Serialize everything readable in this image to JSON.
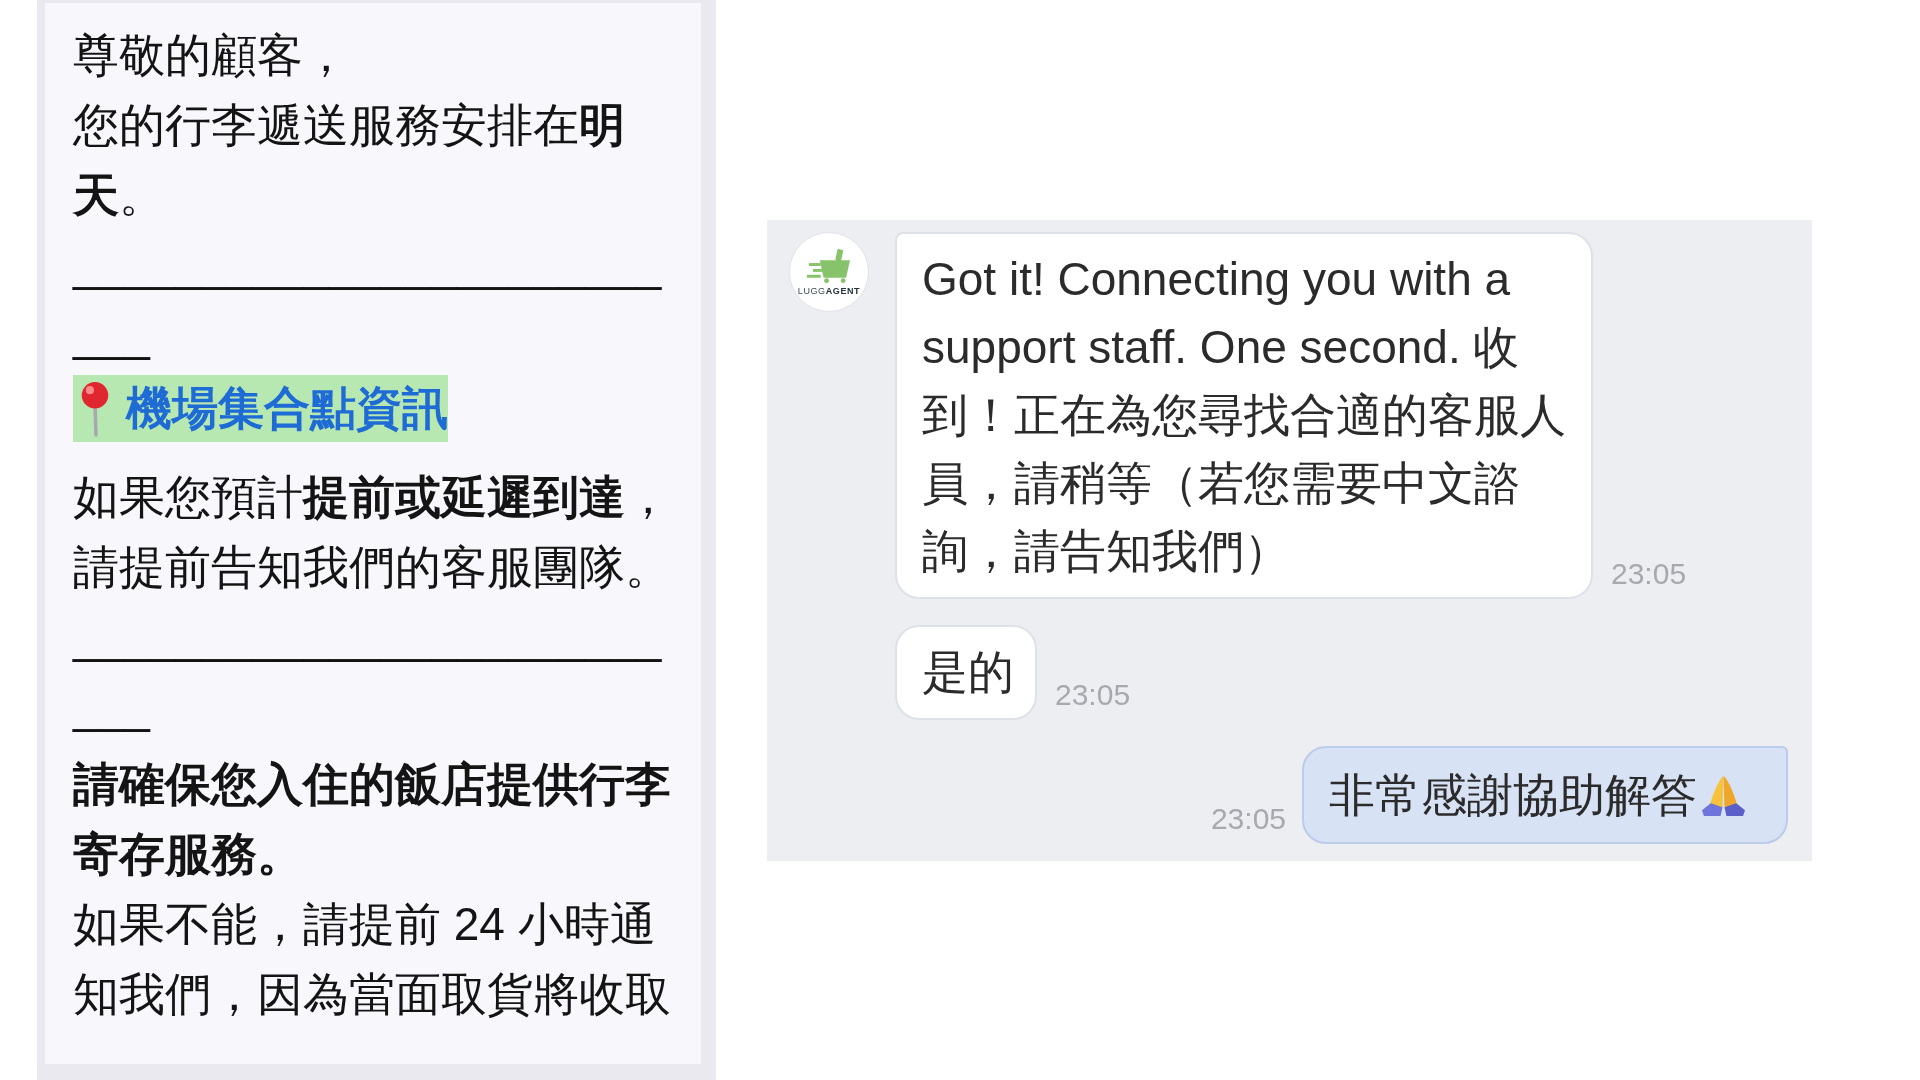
{
  "message_panel": {
    "blocks": [
      {
        "kind": "text",
        "text": "尊敬的顧客，"
      },
      {
        "kind": "text",
        "text": "您的行李遞送服務安排在**明天**。"
      },
      {
        "kind": "divider",
        "text": "__________________________"
      },
      {
        "kind": "heading",
        "text": "機場集合點資訊"
      },
      {
        "kind": "text",
        "text": "如果您預計**提前或延遲到達**，請提前告知我們的客服團隊。"
      },
      {
        "kind": "divider",
        "text": "__________________________"
      },
      {
        "kind": "bold",
        "text": "請確保您入住的飯店提供行李寄存服務。"
      },
      {
        "kind": "text",
        "text": "如果不能，請提前 24 小時通知我們，因為當面取貨將收取"
      }
    ]
  },
  "chat": {
    "messages": [
      {
        "kind": "incoming",
        "avatar": {
          "logo_text": "LUGG**AGENT**"
        },
        "text": "Got it! Connecting you with a support staff. One second. 收到！正在為您尋找合適的客服人員，請稍等（若您需要中文諮詢，請告知我們）",
        "time": "23:05"
      },
      {
        "kind": "incoming",
        "text": "是的",
        "time": "23:05"
      },
      {
        "kind": "outgoing",
        "text": "非常感謝協助解答",
        "time": "23:05"
      }
    ]
  }
}
